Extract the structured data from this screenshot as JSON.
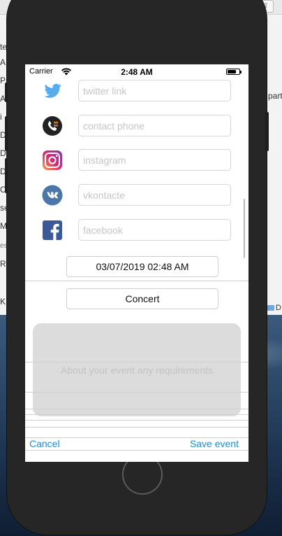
{
  "desktop": {
    "left_fragments": [
      "te",
      "A",
      "P",
      "A",
      "i",
      "D",
      "D",
      "D",
      "C",
      "se",
      "M",
      "es",
      "R",
      "K"
    ],
    "right_fragments": [
      "part"
    ],
    "folder_label": "D"
  },
  "status_bar": {
    "carrier": "Carrier",
    "time": "2:48 AM",
    "battery_level": 0.75
  },
  "social_links": [
    {
      "network": "twitter",
      "icon": "twitter-icon",
      "placeholder": "twitter link",
      "color": "#55acee"
    },
    {
      "network": "contact-phone",
      "icon": "phone-icon",
      "placeholder": "contact phone",
      "color": "#222222"
    },
    {
      "network": "instagram",
      "icon": "instagram-icon",
      "placeholder": "instagram",
      "color": "#c13584"
    },
    {
      "network": "vkontacte",
      "icon": "vk-icon",
      "placeholder": "vkontacte",
      "color": "#4a76a8"
    },
    {
      "network": "facebook",
      "icon": "facebook-icon",
      "placeholder": "facebook",
      "color": "#3b5998"
    }
  ],
  "event": {
    "datetime": "03/07/2019 02:48 AM",
    "category": "Concert",
    "about_placeholder": "About your event any requirements"
  },
  "actions": {
    "cancel_label": "Cancel",
    "save_label": "Save event",
    "accent_color": "#1a8fd6"
  }
}
